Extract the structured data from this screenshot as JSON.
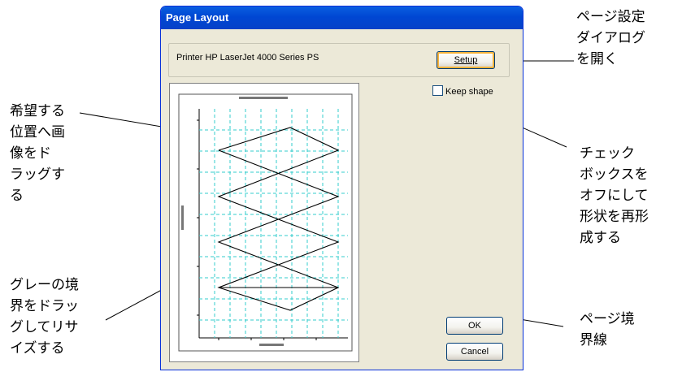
{
  "dialog": {
    "title": "Page Layout",
    "printer_text": "Printer   HP LaserJet 4000 Series PS",
    "setup_button": "Setup",
    "keep_shape_label": "Keep shape",
    "keep_shape_checked": false,
    "ok_button": "OK",
    "cancel_button": "Cancel"
  },
  "annotations": {
    "setup_note": [
      "ページ設定",
      "ダイアログ",
      "を開く"
    ],
    "drag_note": [
      "希望する",
      "位置へ画",
      "像をド",
      "ラッグす",
      "る"
    ],
    "checkbox_note": [
      "チェック",
      "ボックスを",
      "オフにして",
      "形状を再形",
      "成する"
    ],
    "resize_note": [
      "グレーの境",
      "界をドラッ",
      "グしてリサ",
      "イズする"
    ],
    "page_border_note": [
      "ページ境",
      "界線"
    ]
  },
  "colors": {
    "title_bar": "#0a5fe0",
    "dialog_face": "#ece9d8",
    "grid_line": "#33cccc"
  }
}
